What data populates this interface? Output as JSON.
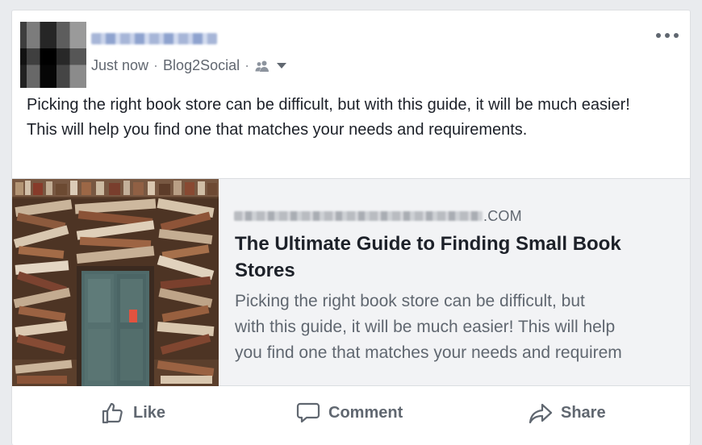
{
  "post": {
    "meta": {
      "time": "Just now",
      "separator": "·",
      "app": "Blog2Social",
      "separator2": "·"
    },
    "message": "Picking the right book store can be difficult, but with this guide, it will be much easier! This will help you find one that matches your needs and requirements."
  },
  "link_preview": {
    "domain_suffix": ".COM",
    "title": "The Ultimate Guide to Finding Small Book Stores",
    "description_lines": [
      "Picking the right book store can be difficult, but",
      "with this guide, it will be much easier! This will help",
      "you find one that matches your needs and requirem"
    ]
  },
  "actions": {
    "like": "Like",
    "comment": "Comment",
    "share": "Share"
  },
  "icons": {
    "privacy": "friends-icon",
    "menu": "more-icon",
    "like": "thumbs-up-icon",
    "comment": "speech-bubble-icon",
    "share": "share-arrow-icon"
  }
}
